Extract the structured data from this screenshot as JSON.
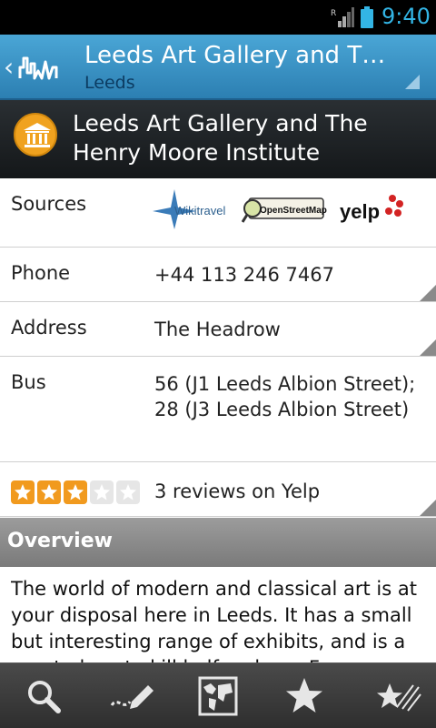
{
  "status_bar": {
    "time": "9:40",
    "signal_label": "R",
    "accent_color": "#33b5e5"
  },
  "action_bar": {
    "title": "Leeds Art Gallery and The…",
    "subtitle": "Leeds",
    "back_icon": "chevron-left-icon",
    "logo_icon": "wikitravel-skyline-icon"
  },
  "poi": {
    "title": "Leeds Art Gallery and The Henry Moore Institute",
    "icon": "museum-icon",
    "icon_color": "#f0a21f"
  },
  "details": {
    "sources_label": "Sources",
    "sources": [
      {
        "name": "Wikitravel",
        "icon": "wikitravel-logo"
      },
      {
        "name": "OpenStreetMap",
        "icon": "openstreetmap-logo"
      },
      {
        "name": "yelp",
        "icon": "yelp-logo"
      }
    ],
    "phone_label": "Phone",
    "phone_value": "+44 113 246 7467",
    "address_label": "Address",
    "address_value": "The Headrow",
    "bus_label": "Bus",
    "bus_value": "56 (J1 Leeds Albion Street); 28 (J3 Leeds Albion Street)",
    "rating": 3,
    "rating_max": 5,
    "reviews_text": "3 reviews on Yelp"
  },
  "overview": {
    "heading": "Overview",
    "text": "The world of modern and classical art is at your disposal here in Leeds. It has a small but interesting range of exhibits, and is a great place to kill half an hour. Free."
  },
  "toolbar": {
    "items": [
      {
        "name": "search",
        "icon": "search-icon"
      },
      {
        "name": "edit",
        "icon": "edit-icon"
      },
      {
        "name": "map",
        "icon": "map-icon"
      },
      {
        "name": "favorite",
        "icon": "star-icon"
      },
      {
        "name": "add-favorite",
        "icon": "star-add-icon"
      }
    ]
  }
}
